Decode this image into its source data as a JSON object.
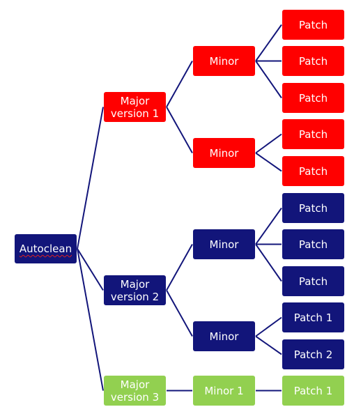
{
  "diagram": {
    "root": {
      "id": "root",
      "label": "Autoclean",
      "color": "blue"
    },
    "colors": {
      "red": "#ff0000",
      "blue": "#12157a",
      "green": "#92d050",
      "line": "#12157a"
    },
    "nodes": [
      {
        "id": "maj1",
        "label": "Major version 1",
        "color": "red",
        "parent": "root"
      },
      {
        "id": "min1a",
        "label": "Minor",
        "color": "red",
        "parent": "maj1"
      },
      {
        "id": "p1a1",
        "label": "Patch",
        "color": "red",
        "parent": "min1a"
      },
      {
        "id": "p1a2",
        "label": "Patch",
        "color": "red",
        "parent": "min1a"
      },
      {
        "id": "p1a3",
        "label": "Patch",
        "color": "red",
        "parent": "min1a"
      },
      {
        "id": "min1b",
        "label": "Minor",
        "color": "red",
        "parent": "maj1"
      },
      {
        "id": "p1b1",
        "label": "Patch",
        "color": "red",
        "parent": "min1b"
      },
      {
        "id": "p1b2",
        "label": "Patch",
        "color": "red",
        "parent": "min1b"
      },
      {
        "id": "maj2",
        "label": "Major version 2",
        "color": "blue",
        "parent": "root"
      },
      {
        "id": "min2a",
        "label": "Minor",
        "color": "blue",
        "parent": "maj2"
      },
      {
        "id": "p2a1",
        "label": "Patch",
        "color": "blue",
        "parent": "min2a"
      },
      {
        "id": "p2a2",
        "label": "Patch",
        "color": "blue",
        "parent": "min2a"
      },
      {
        "id": "p2a3",
        "label": "Patch",
        "color": "blue",
        "parent": "min2a"
      },
      {
        "id": "min2b",
        "label": "Minor",
        "color": "blue",
        "parent": "maj2"
      },
      {
        "id": "p2b1",
        "label": "Patch 1",
        "color": "blue",
        "parent": "min2b"
      },
      {
        "id": "p2b2",
        "label": "Patch 2",
        "color": "blue",
        "parent": "min2b"
      },
      {
        "id": "maj3",
        "label": "Major version 3",
        "color": "green",
        "parent": "root"
      },
      {
        "id": "min3",
        "label": "Minor 1",
        "color": "green",
        "parent": "maj3"
      },
      {
        "id": "p3",
        "label": "Patch 1",
        "color": "green",
        "parent": "min3"
      }
    ]
  }
}
